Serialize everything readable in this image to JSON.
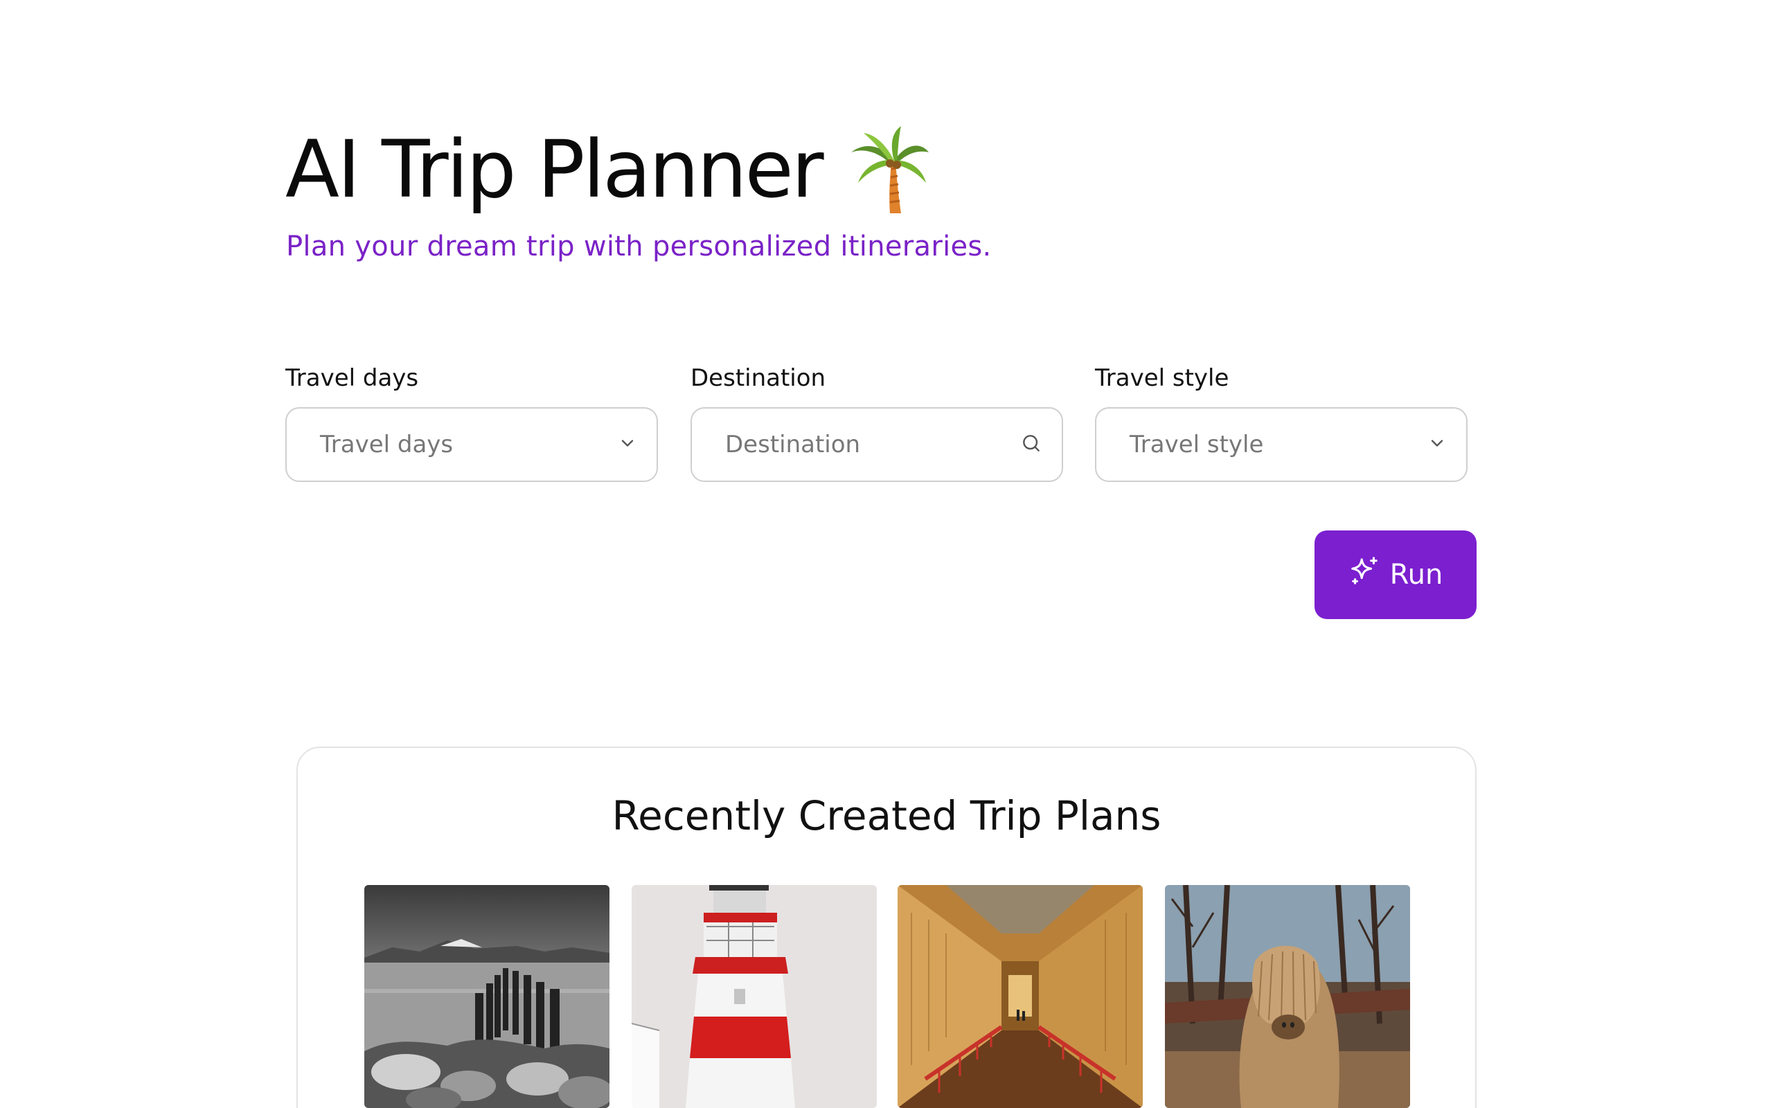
{
  "header": {
    "title": "AI Trip Planner",
    "title_icon": "palm-tree-icon",
    "subtitle": "Plan your dream trip with personalized itineraries."
  },
  "form": {
    "travel_days": {
      "label": "Travel days",
      "placeholder": "Travel days",
      "icon": "chevron-down-icon"
    },
    "destination": {
      "label": "Destination",
      "placeholder": "Destination",
      "icon": "search-icon"
    },
    "travel_style": {
      "label": "Travel style",
      "placeholder": "Travel style",
      "icon": "chevron-down-icon"
    },
    "run_button": {
      "label": "Run",
      "icon": "sparkle-icon"
    }
  },
  "recent": {
    "title": "Recently Created Trip Plans",
    "plans": [
      {
        "image": "lake-pier-monochrome"
      },
      {
        "image": "red-white-lighthouse"
      },
      {
        "image": "egyptian-tomb-corridor"
      },
      {
        "image": "alpaca"
      }
    ]
  },
  "colors": {
    "accent": "#7b1fcf",
    "subtitle": "#7a22c7",
    "border": "#cfcfcf"
  }
}
